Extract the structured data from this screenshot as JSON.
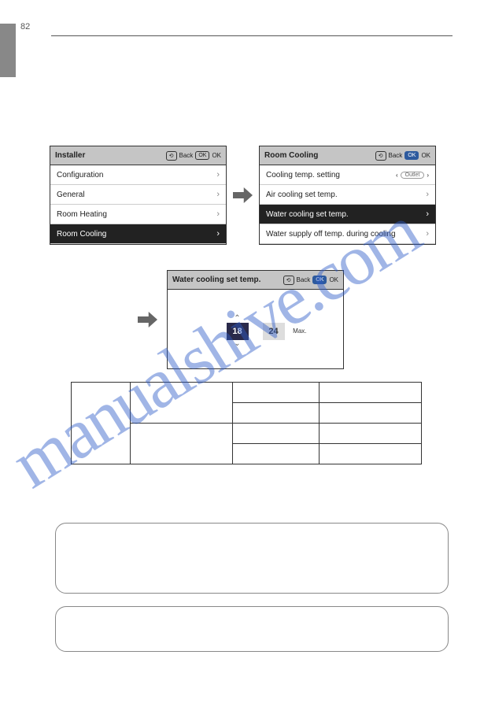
{
  "page_number": "82",
  "watermark": "manualshive.com",
  "panel_left": {
    "title": "Installer",
    "back_label": "Back",
    "ok_label": "OK",
    "rows": [
      {
        "label": "Configuration",
        "selected": false
      },
      {
        "label": "General",
        "selected": false
      },
      {
        "label": "Room Heating",
        "selected": false
      },
      {
        "label": "Room Cooling",
        "selected": true
      }
    ]
  },
  "panel_right": {
    "title": "Room Cooling",
    "back_label": "Back",
    "ok_label": "OK",
    "rows": [
      {
        "label": "Cooling temp. setting",
        "badge": "Outlet"
      },
      {
        "label": "Air cooling set temp."
      },
      {
        "label": "Water cooling set temp.",
        "selected": true
      },
      {
        "label": "Water supply off temp. during cooling"
      }
    ]
  },
  "panel_center": {
    "title": "Water cooling set temp.",
    "back_label": "Back",
    "ok_label": "OK",
    "max_label": "Max.",
    "value_left": "18",
    "value_right": "24"
  }
}
